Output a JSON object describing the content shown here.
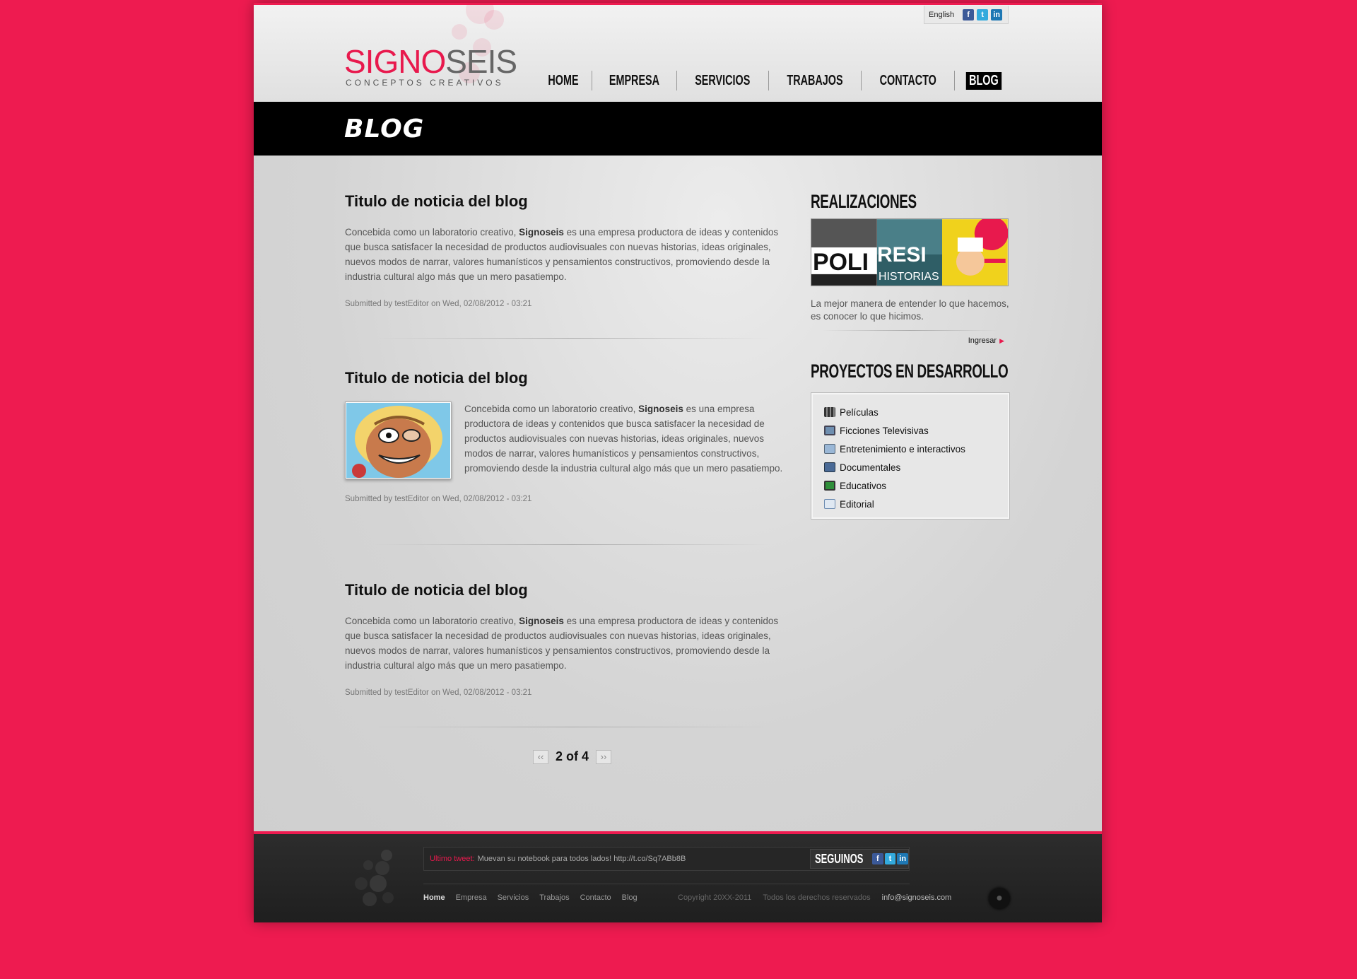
{
  "topbar": {
    "language": "English",
    "social": [
      "f",
      "t",
      "in"
    ]
  },
  "logo": {
    "part1": "SIGNO",
    "part2": "SEIS",
    "tagline": "CONCEPTOS CREATIVOS"
  },
  "nav": {
    "items": [
      "HOME",
      "EMPRESA",
      "SERVICIOS",
      "TRABAJOS",
      "CONTACTO",
      "BLOG"
    ],
    "active": "BLOG"
  },
  "page_title": "BLOG",
  "posts": [
    {
      "title": "Titulo de noticia del blog",
      "body_before": "Concebida como un laboratorio creativo, ",
      "brand": "Signoseis",
      "body_after": " es una empresa productora de ideas y contenidos que busca satisfacer la necesidad de productos audiovisuales con nuevas historias, ideas originales, nuevos modos de narrar, valores humanísticos y pensamientos constructivos, promoviendo desde la industria cultural algo más que un mero pasatiempo.",
      "meta": "Submitted by testEditor on Wed, 02/08/2012 - 03:21"
    },
    {
      "title": "Titulo de noticia del blog",
      "body_before": "Concebida como un laboratorio creativo, ",
      "brand": "Signoseis",
      "body_after": " es una empresa productora de ideas y contenidos que busca satisfacer la necesidad de productos audiovisuales con nuevas historias, ideas originales, nuevos modos de narrar, valores humanísticos y pensamientos constructivos, promoviendo desde la industria cultural algo más que un mero pasatiempo.",
      "meta": "Submitted by testEditor on Wed, 02/08/2012 - 03:21"
    },
    {
      "title": "Titulo de noticia del blog",
      "body_before": "Concebida como un laboratorio creativo, ",
      "brand": "Signoseis",
      "body_after": " es una empresa productora de ideas y contenidos que busca satisfacer la necesidad de productos audiovisuales con nuevas historias, ideas originales, nuevos modos de narrar, valores humanísticos y pensamientos constructivos, promoviendo desde la industria cultural algo más que un mero pasatiempo.",
      "meta": "Submitted by testEditor on Wed, 02/08/2012 - 03:21"
    }
  ],
  "pager": {
    "prev": "‹‹",
    "text": "2 of 4",
    "next": "››"
  },
  "sidebar": {
    "realizaciones": {
      "title": "REALIZACIONES",
      "gallery_texts": [
        "POLI",
        "RESI",
        "HISTORIAS"
      ],
      "text": "La mejor manera de entender lo que hacemos, es conocer lo que hicimos.",
      "link": "Ingresar"
    },
    "proyectos": {
      "title": "PROYECTOS EN DESARROLLO",
      "items": [
        {
          "label": "Películas",
          "icon": "film-icon"
        },
        {
          "label": "Ficciones Televisivas",
          "icon": "tv-icon"
        },
        {
          "label": "Entretenimiento e interactivos",
          "icon": "interactive-icon"
        },
        {
          "label": "Documentales",
          "icon": "documentary-icon"
        },
        {
          "label": "Educativos",
          "icon": "education-icon"
        },
        {
          "label": "Editorial",
          "icon": "book-icon"
        }
      ]
    }
  },
  "footer": {
    "tweet_label": "Ultimo tweet:",
    "tweet_text": "Muevan su notebook para todos lados! http://t.co/Sq7ABb8B",
    "follow_label": "SEGUINOS",
    "nav": [
      "Home",
      "Empresa",
      "Servicios",
      "Trabajos",
      "Contacto",
      "Blog"
    ],
    "copyright": "Copyright 20XX-2011",
    "rights": "Todos los derechos reservados",
    "email": "info@signoseis.com"
  },
  "colors": {
    "background": "#ee1b50",
    "accent": "#e8194d",
    "titlebar": "#000000"
  }
}
